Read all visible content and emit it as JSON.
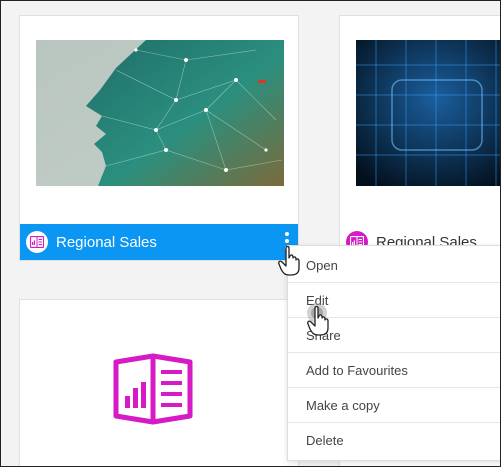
{
  "cards": [
    {
      "title": "Regional Sales",
      "state": "selected",
      "badge_icon": "report-icon",
      "thumbnail": "digital-face-profile"
    },
    {
      "title": "Regional Sales",
      "state": "normal",
      "badge_icon": "report-icon",
      "thumbnail": "blue-grid"
    },
    {
      "title": "",
      "state": "normal",
      "placeholder_icon": "report-book-icon"
    },
    {
      "title": "",
      "state": "normal"
    }
  ],
  "context_menu": {
    "items": [
      {
        "label": "Open"
      },
      {
        "label": "Edit"
      },
      {
        "label": "Share"
      },
      {
        "label": "Add to Favourites"
      },
      {
        "label": "Make a copy"
      },
      {
        "label": "Delete"
      }
    ]
  },
  "colors": {
    "accent": "#0a96f2",
    "badge": "#d51ac6",
    "placeholder_icon": "#d51ac6"
  },
  "cursors": [
    "hand-pointer-icon",
    "hand-pointer-icon"
  ]
}
